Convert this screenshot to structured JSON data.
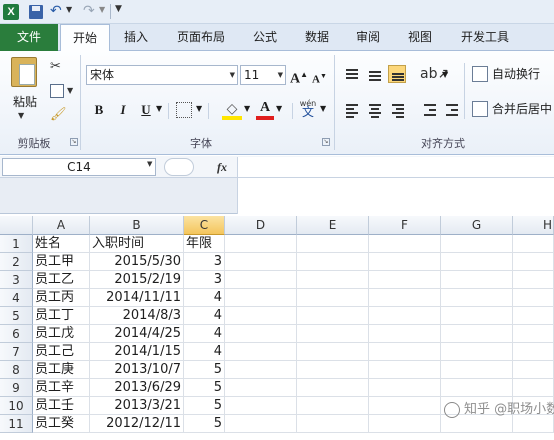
{
  "qat": {
    "app_logo": "X",
    "undo_icon": "↶",
    "redo_icon": "↷"
  },
  "tabs": [
    "文件",
    "开始",
    "插入",
    "页面布局",
    "公式",
    "数据",
    "审阅",
    "视图",
    "开发工具"
  ],
  "clipboard": {
    "paste": "粘贴",
    "group": "剪贴板"
  },
  "font": {
    "name": "宋体",
    "size": "11",
    "group": "字体",
    "grow": "A",
    "shrink": "A",
    "bold": "B",
    "italic": "I",
    "underline": "U",
    "color_letter": "A",
    "phonetic": "wén"
  },
  "alignment": {
    "wrap": "自动换行",
    "merge": "合并后居中",
    "group": "对齐方式"
  },
  "formula_bar": {
    "name_box": "C14",
    "fx": "fx",
    "value": ""
  },
  "columns": [
    "A",
    "B",
    "C",
    "D",
    "E",
    "F",
    "G",
    "H"
  ],
  "active_column": "C",
  "rows": [
    "1",
    "2",
    "3",
    "4",
    "5",
    "6",
    "7",
    "8",
    "9",
    "10",
    "11"
  ],
  "table": [
    [
      "姓名",
      "入职时间",
      "年限"
    ],
    [
      "员工甲",
      "2015/5/30",
      "3"
    ],
    [
      "员工乙",
      "2015/2/19",
      "3"
    ],
    [
      "员工丙",
      "2014/11/11",
      "4"
    ],
    [
      "员工丁",
      "2014/8/3",
      "4"
    ],
    [
      "员工戊",
      "2014/4/25",
      "4"
    ],
    [
      "员工己",
      "2014/1/15",
      "4"
    ],
    [
      "员工庚",
      "2013/10/7",
      "5"
    ],
    [
      "员工辛",
      "2013/6/29",
      "5"
    ],
    [
      "员工壬",
      "2013/3/21",
      "5"
    ],
    [
      "员工癸",
      "2012/12/11",
      "5"
    ]
  ],
  "watermark": "知乎 @职场小数",
  "colors": {
    "file_tab": "#2a7d3c",
    "active_header": "#f4c55c",
    "selected_button": "#fcd77b"
  }
}
